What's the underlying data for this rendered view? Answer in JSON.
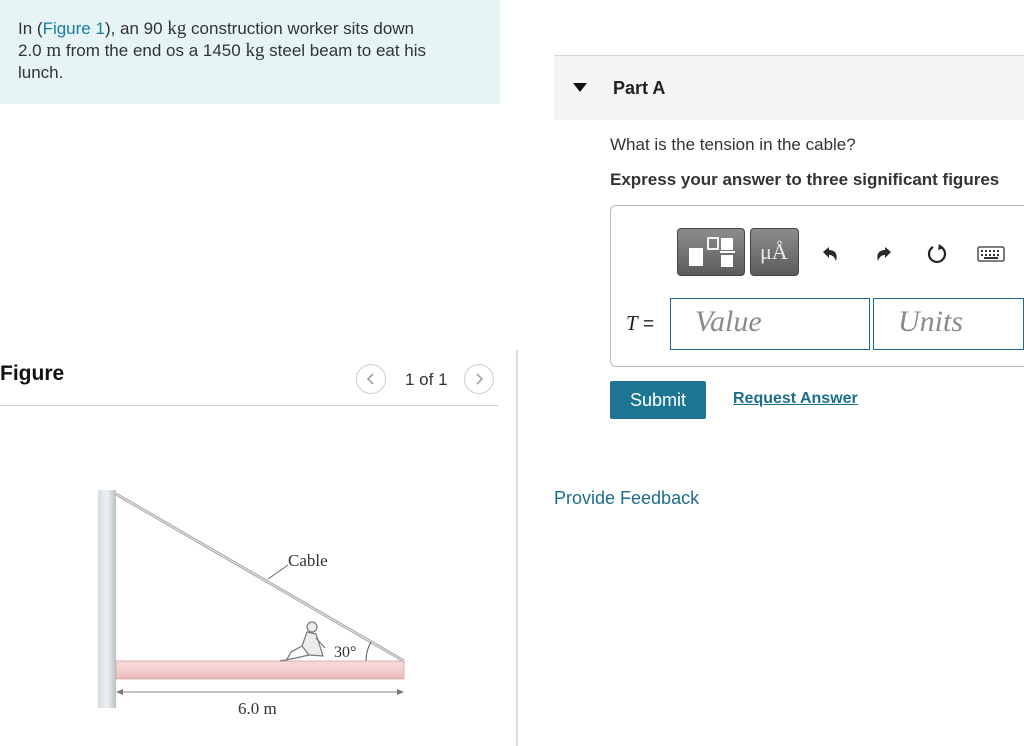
{
  "problem": {
    "prefix": "In (",
    "figure_link": "Figure 1",
    "text1": "), an 90 ",
    "unit_kg": "kg",
    "text2": " construction worker sits down",
    "dist_value": "2.0 ",
    "unit_m": "m",
    "text3": " from the end os a 1450 ",
    "unit_kg2": "kg",
    "text4": " steel beam to eat his",
    "text5": "lunch."
  },
  "figure": {
    "title": "Figure",
    "pager": "1 of 1",
    "cable_label": "Cable",
    "angle_label": "30°",
    "length_label": "6.0 m",
    "prev_icon": "chevron-left-icon",
    "next_icon": "chevron-right-icon"
  },
  "part": {
    "title": "Part A",
    "caret_icon": "caret-down-icon",
    "question": "What is the tension in the cable?",
    "instruction": "Express your answer to three significant figures",
    "variable": "T",
    "equals": " =",
    "value_placeholder": "Value",
    "units_placeholder": "Units",
    "toolbar": {
      "template_icon": "fraction-template-icon",
      "units_button": "μÅ",
      "undo_icon": "undo-icon",
      "redo_icon": "redo-icon",
      "reset_icon": "reset-icon",
      "keyboard_icon": "keyboard-icon"
    },
    "submit_label": "Submit",
    "request_label": "Request Answer"
  },
  "feedback_label": "Provide Feedback",
  "colors": {
    "accent": "#1c7593",
    "link": "#1b7c9e",
    "problem_bg": "#e6f4f5"
  }
}
